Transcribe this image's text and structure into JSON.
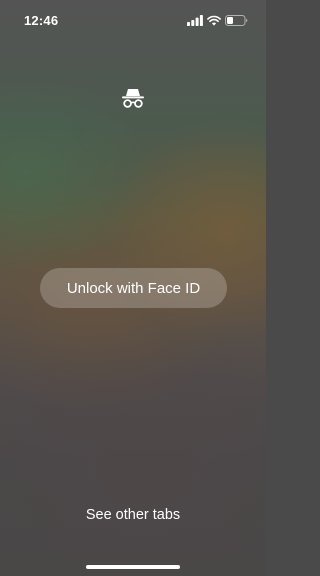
{
  "status_bar": {
    "time": "12:46",
    "signal_icon": "cellular-signal-icon",
    "wifi_icon": "wifi-icon",
    "battery_icon": "battery-icon"
  },
  "lock_screen": {
    "incognito_icon": "incognito-icon",
    "unlock_label": "Unlock with Face ID",
    "other_tabs_label": "See other tabs"
  },
  "colors": {
    "text": "#ffffff",
    "button_fill": "rgba(255,255,255,0.22)"
  }
}
